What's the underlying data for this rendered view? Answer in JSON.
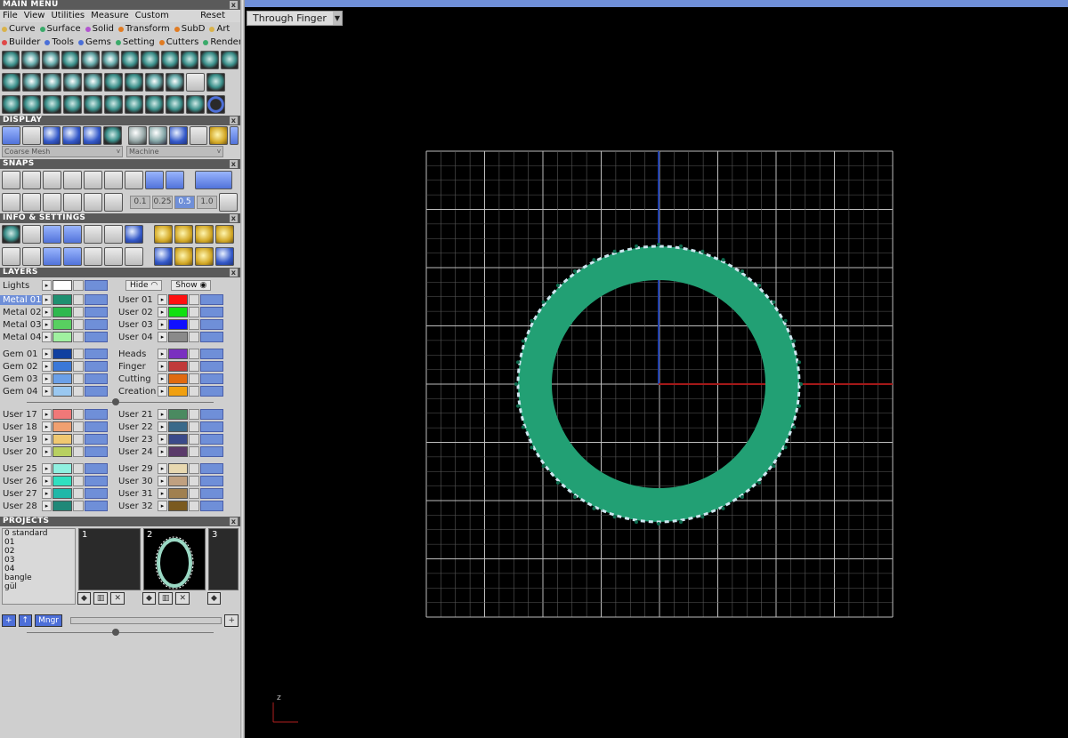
{
  "main_menu": {
    "title": "MAIN MENU",
    "menus": [
      "File",
      "View",
      "Utilities",
      "Measure",
      "Custom"
    ],
    "reset": "Reset",
    "categories_row1": [
      {
        "label": "Curve",
        "color": "#d9b24a"
      },
      {
        "label": "Surface",
        "color": "#3aaa6a"
      },
      {
        "label": "Solid",
        "color": "#b255d0"
      },
      {
        "label": "Transform",
        "color": "#e07b22"
      },
      {
        "label": "SubD",
        "color": "#e07b22"
      },
      {
        "label": "Art",
        "color": "#d9b24a"
      }
    ],
    "categories_row2": [
      {
        "label": "Builder",
        "color": "#e04848"
      },
      {
        "label": "Tools",
        "color": "#4a6fd8"
      },
      {
        "label": "Gems",
        "color": "#4a6fd8"
      },
      {
        "label": "Setting",
        "color": "#3aaa6a"
      },
      {
        "label": "Cutters",
        "color": "#e07b22"
      },
      {
        "label": "Render",
        "color": "#3aaa6a"
      }
    ]
  },
  "display": {
    "title": "DISPLAY",
    "mesh_select": "Coarse Mesh",
    "material_select": "Machine"
  },
  "snaps": {
    "title": "SNAPS",
    "values": [
      "0.1",
      "0.25",
      "0.5",
      "1.0"
    ],
    "active_value": "0.5"
  },
  "info": {
    "title": "INFO & SETTINGS"
  },
  "layers": {
    "title": "LAYERS",
    "lights": "Lights",
    "hide": "Hide",
    "show": "Show",
    "groups": [
      [
        {
          "l": "Metal 01",
          "lc": "#1e9070",
          "r": "User 01",
          "rc": "#ff1010",
          "sel": true
        },
        {
          "l": "Metal 02",
          "lc": "#2fb84f",
          "r": "User 02",
          "rc": "#10e010"
        },
        {
          "l": "Metal 03",
          "lc": "#58d060",
          "r": "User 03",
          "rc": "#1010ff"
        },
        {
          "l": "Metal 04",
          "lc": "#a0f0a0",
          "r": "User 04",
          "rc": "#8a8a8a"
        }
      ],
      [
        {
          "l": "Gem 01",
          "lc": "#1040a0",
          "r": "Heads",
          "rc": "#7a30c0"
        },
        {
          "l": "Gem 02",
          "lc": "#3a78d8",
          "r": "Finger",
          "rc": "#c03a3a"
        },
        {
          "l": "Gem 03",
          "lc": "#6aa0e8",
          "r": "Cutting",
          "rc": "#e06a10"
        },
        {
          "l": "Gem 04",
          "lc": "#9ac8f0",
          "r": "Creation",
          "rc": "#f0a010"
        }
      ],
      [
        {
          "l": "User 17",
          "lc": "#f07878",
          "r": "User 21",
          "rc": "#4a8a60"
        },
        {
          "l": "User 18",
          "lc": "#f0a070",
          "r": "User 22",
          "rc": "#3a6a8a"
        },
        {
          "l": "User 19",
          "lc": "#f0c870",
          "r": "User 23",
          "rc": "#3a4a8a"
        },
        {
          "l": "User 20",
          "lc": "#b8d060",
          "r": "User 24",
          "rc": "#5a3a6a"
        }
      ],
      [
        {
          "l": "User 25",
          "lc": "#90f0e0",
          "r": "User 29",
          "rc": "#e8d8b0"
        },
        {
          "l": "User 26",
          "lc": "#30e0c0",
          "r": "User 30",
          "rc": "#c0a080"
        },
        {
          "l": "User 27",
          "lc": "#20b8a8",
          "r": "User 31",
          "rc": "#a08050"
        },
        {
          "l": "User 28",
          "lc": "#208878",
          "r": "User 32",
          "rc": "#7a5a20"
        }
      ]
    ]
  },
  "projects": {
    "title": "PROJECTS",
    "list": [
      "0 standard",
      "01",
      "02",
      "03",
      "04",
      "bangle",
      "gül"
    ],
    "thumbs": [
      "1",
      "2",
      "3"
    ],
    "manager_button": "Mngr"
  },
  "viewport": {
    "view_name": "Through Finger",
    "axis_label": "z",
    "ring_color": "#22a074"
  }
}
